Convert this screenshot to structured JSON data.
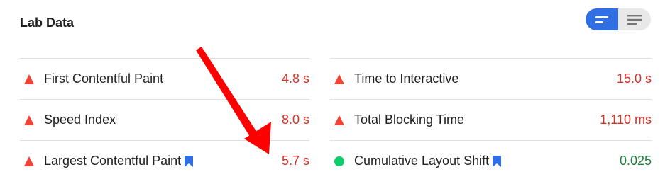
{
  "header": {
    "title": "Lab Data",
    "view_toggle": {
      "options": [
        {
          "icon": "summary-view-icon",
          "active": true
        },
        {
          "icon": "list-view-icon",
          "active": false
        }
      ]
    }
  },
  "colors": {
    "fail": "#d93025",
    "pass": "#188038",
    "fail_indicator": "#f44336",
    "pass_indicator": "#0cce6b",
    "toggle_active": "#2f6fe3",
    "annotation_arrow": "#ff0000"
  },
  "metrics_left": [
    {
      "label": "First Contentful Paint",
      "value": "4.8 s",
      "status": "fail",
      "bookmark": false
    },
    {
      "label": "Speed Index",
      "value": "8.0 s",
      "status": "fail",
      "bookmark": false
    },
    {
      "label": "Largest Contentful Paint",
      "value": "5.7 s",
      "status": "fail",
      "bookmark": true
    }
  ],
  "metrics_right": [
    {
      "label": "Time to Interactive",
      "value": "15.0 s",
      "status": "fail",
      "bookmark": false
    },
    {
      "label": "Total Blocking Time",
      "value": "1,110 ms",
      "status": "fail",
      "bookmark": false
    },
    {
      "label": "Cumulative Layout Shift",
      "value": "0.025",
      "status": "pass",
      "bookmark": true
    }
  ]
}
